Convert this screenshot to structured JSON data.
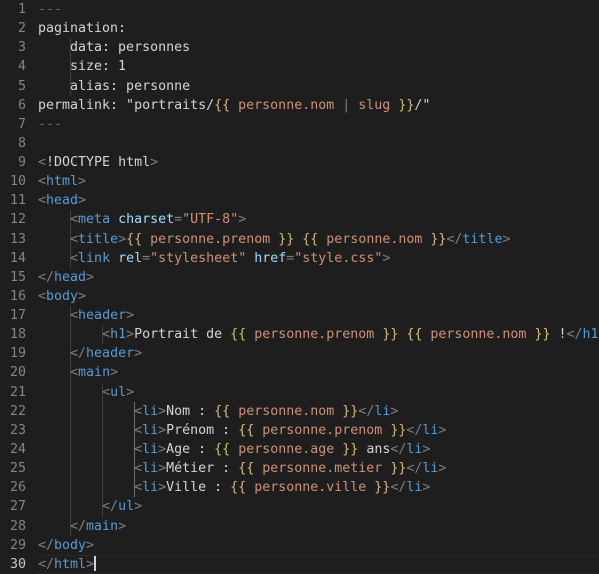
{
  "editor": {
    "theme_name": "dark-plus",
    "background_color": "#1e1e1e",
    "gutter_text_color": "#858585",
    "active_line_number_color": "#c6c6c6",
    "default_text_color": "#d4d4d4",
    "total_lines": 30,
    "active_line": 30,
    "cursor_line": 30,
    "cursor_column": 8,
    "tab_size": 4,
    "colors": {
      "tag": "#569cd6",
      "bracket": "#808080",
      "attribute": "#9cdcfe",
      "string": "#ce9178",
      "template_delimiter": "#d7ba7d",
      "variable": "#ce9178",
      "comment_dim": "#6a6a6a",
      "indent_guide": "#404040",
      "indent_guide_active": "#707070",
      "cursor": "#d4d4d4"
    },
    "lines": [
      {
        "num": "1",
        "indent": 0,
        "tokens": [
          {
            "t": "---",
            "c": "t-dim"
          }
        ]
      },
      {
        "num": "2",
        "indent": 0,
        "tokens": [
          {
            "t": "pagination:",
            "c": "t-plain"
          }
        ]
      },
      {
        "num": "3",
        "indent": 1,
        "tokens": [
          {
            "t": "    data: personnes",
            "c": "t-plain"
          }
        ]
      },
      {
        "num": "4",
        "indent": 1,
        "tokens": [
          {
            "t": "    size: 1",
            "c": "t-plain"
          }
        ]
      },
      {
        "num": "5",
        "indent": 1,
        "tokens": [
          {
            "t": "    alias: personne",
            "c": "t-plain"
          }
        ]
      },
      {
        "num": "6",
        "indent": 0,
        "tokens": [
          {
            "t": "permalink: \"portraits/",
            "c": "t-plain"
          },
          {
            "t": "{{",
            "c": "t-delim"
          },
          {
            "t": " ",
            "c": "t-plain"
          },
          {
            "t": "personne.nom",
            "c": "t-var"
          },
          {
            "t": " ",
            "c": "t-plain"
          },
          {
            "t": "|",
            "c": "t-op"
          },
          {
            "t": " ",
            "c": "t-plain"
          },
          {
            "t": "slug",
            "c": "t-var"
          },
          {
            "t": " ",
            "c": "t-plain"
          },
          {
            "t": "}}",
            "c": "t-delim"
          },
          {
            "t": "/\"",
            "c": "t-plain"
          }
        ]
      },
      {
        "num": "7",
        "indent": 0,
        "tokens": [
          {
            "t": "---",
            "c": "t-dim"
          }
        ]
      },
      {
        "num": "8",
        "indent": 0,
        "tokens": []
      },
      {
        "num": "9",
        "indent": 0,
        "tokens": [
          {
            "t": "<",
            "c": "t-brack"
          },
          {
            "t": "!DOCTYPE",
            "c": "t-plain"
          },
          {
            "t": " ",
            "c": "t-plain"
          },
          {
            "t": "html",
            "c": "t-plain"
          },
          {
            "t": ">",
            "c": "t-brack"
          }
        ]
      },
      {
        "num": "10",
        "indent": 0,
        "tokens": [
          {
            "t": "<",
            "c": "t-brack"
          },
          {
            "t": "html",
            "c": "t-tag"
          },
          {
            "t": ">",
            "c": "t-brack"
          }
        ]
      },
      {
        "num": "11",
        "indent": 0,
        "tokens": [
          {
            "t": "<",
            "c": "t-brack"
          },
          {
            "t": "head",
            "c": "t-tag"
          },
          {
            "t": ">",
            "c": "t-brack"
          }
        ]
      },
      {
        "num": "12",
        "indent": 1,
        "tokens": [
          {
            "t": "    ",
            "c": "t-plain"
          },
          {
            "t": "<",
            "c": "t-brack"
          },
          {
            "t": "meta",
            "c": "t-tag"
          },
          {
            "t": " ",
            "c": "t-plain"
          },
          {
            "t": "charset",
            "c": "t-attr"
          },
          {
            "t": "=",
            "c": "t-brack"
          },
          {
            "t": "\"UTF-8\"",
            "c": "t-str"
          },
          {
            "t": ">",
            "c": "t-brack"
          }
        ]
      },
      {
        "num": "13",
        "indent": 1,
        "tokens": [
          {
            "t": "    ",
            "c": "t-plain"
          },
          {
            "t": "<",
            "c": "t-brack"
          },
          {
            "t": "title",
            "c": "t-tag"
          },
          {
            "t": ">",
            "c": "t-brack"
          },
          {
            "t": "{{",
            "c": "t-delim"
          },
          {
            "t": " ",
            "c": "t-plain"
          },
          {
            "t": "personne.prenom",
            "c": "t-var"
          },
          {
            "t": " ",
            "c": "t-plain"
          },
          {
            "t": "}}",
            "c": "t-delim"
          },
          {
            "t": " ",
            "c": "t-plain"
          },
          {
            "t": "{{",
            "c": "t-delim"
          },
          {
            "t": " ",
            "c": "t-plain"
          },
          {
            "t": "personne.nom",
            "c": "t-var"
          },
          {
            "t": " ",
            "c": "t-plain"
          },
          {
            "t": "}}",
            "c": "t-delim"
          },
          {
            "t": "</",
            "c": "t-brack"
          },
          {
            "t": "title",
            "c": "t-tag"
          },
          {
            "t": ">",
            "c": "t-brack"
          }
        ]
      },
      {
        "num": "14",
        "indent": 1,
        "tokens": [
          {
            "t": "    ",
            "c": "t-plain"
          },
          {
            "t": "<",
            "c": "t-brack"
          },
          {
            "t": "link",
            "c": "t-tag"
          },
          {
            "t": " ",
            "c": "t-plain"
          },
          {
            "t": "rel",
            "c": "t-attr"
          },
          {
            "t": "=",
            "c": "t-brack"
          },
          {
            "t": "\"stylesheet\"",
            "c": "t-str"
          },
          {
            "t": " ",
            "c": "t-plain"
          },
          {
            "t": "href",
            "c": "t-attr"
          },
          {
            "t": "=",
            "c": "t-brack"
          },
          {
            "t": "\"style.css\"",
            "c": "t-str"
          },
          {
            "t": ">",
            "c": "t-brack"
          }
        ]
      },
      {
        "num": "15",
        "indent": 0,
        "tokens": [
          {
            "t": "</",
            "c": "t-brack"
          },
          {
            "t": "head",
            "c": "t-tag"
          },
          {
            "t": ">",
            "c": "t-brack"
          }
        ]
      },
      {
        "num": "16",
        "indent": 0,
        "tokens": [
          {
            "t": "<",
            "c": "t-brack"
          },
          {
            "t": "body",
            "c": "t-tag"
          },
          {
            "t": ">",
            "c": "t-brack"
          }
        ]
      },
      {
        "num": "17",
        "indent": 1,
        "tokens": [
          {
            "t": "    ",
            "c": "t-plain"
          },
          {
            "t": "<",
            "c": "t-brack"
          },
          {
            "t": "header",
            "c": "t-tag"
          },
          {
            "t": ">",
            "c": "t-brack"
          }
        ]
      },
      {
        "num": "18",
        "indent": 2,
        "tokens": [
          {
            "t": "        ",
            "c": "t-plain"
          },
          {
            "t": "<",
            "c": "t-brack"
          },
          {
            "t": "h1",
            "c": "t-tag"
          },
          {
            "t": ">",
            "c": "t-brack"
          },
          {
            "t": "Portrait de ",
            "c": "t-plain"
          },
          {
            "t": "{{",
            "c": "t-delim"
          },
          {
            "t": " ",
            "c": "t-plain"
          },
          {
            "t": "personne.prenom",
            "c": "t-var"
          },
          {
            "t": " ",
            "c": "t-plain"
          },
          {
            "t": "}}",
            "c": "t-delim"
          },
          {
            "t": " ",
            "c": "t-plain"
          },
          {
            "t": "{{",
            "c": "t-delim"
          },
          {
            "t": " ",
            "c": "t-plain"
          },
          {
            "t": "personne.nom",
            "c": "t-var"
          },
          {
            "t": " ",
            "c": "t-plain"
          },
          {
            "t": "}}",
            "c": "t-delim"
          },
          {
            "t": " !",
            "c": "t-plain"
          },
          {
            "t": "</",
            "c": "t-brack"
          },
          {
            "t": "h1",
            "c": "t-tag"
          },
          {
            "t": ">",
            "c": "t-brack"
          }
        ]
      },
      {
        "num": "19",
        "indent": 1,
        "tokens": [
          {
            "t": "    ",
            "c": "t-plain"
          },
          {
            "t": "</",
            "c": "t-brack"
          },
          {
            "t": "header",
            "c": "t-tag"
          },
          {
            "t": ">",
            "c": "t-brack"
          }
        ]
      },
      {
        "num": "20",
        "indent": 1,
        "tokens": [
          {
            "t": "    ",
            "c": "t-plain"
          },
          {
            "t": "<",
            "c": "t-brack"
          },
          {
            "t": "main",
            "c": "t-tag"
          },
          {
            "t": ">",
            "c": "t-brack"
          }
        ]
      },
      {
        "num": "21",
        "indent": 2,
        "tokens": [
          {
            "t": "        ",
            "c": "t-plain"
          },
          {
            "t": "<",
            "c": "t-brack"
          },
          {
            "t": "ul",
            "c": "t-tag"
          },
          {
            "t": ">",
            "c": "t-brack"
          }
        ]
      },
      {
        "num": "22",
        "indent": 3,
        "tokens": [
          {
            "t": "            ",
            "c": "t-plain"
          },
          {
            "t": "<",
            "c": "t-brack"
          },
          {
            "t": "li",
            "c": "t-tag"
          },
          {
            "t": ">",
            "c": "t-brack"
          },
          {
            "t": "Nom : ",
            "c": "t-plain"
          },
          {
            "t": "{{",
            "c": "t-delim"
          },
          {
            "t": " ",
            "c": "t-plain"
          },
          {
            "t": "personne.nom",
            "c": "t-var"
          },
          {
            "t": " ",
            "c": "t-plain"
          },
          {
            "t": "}}",
            "c": "t-delim"
          },
          {
            "t": "</",
            "c": "t-brack"
          },
          {
            "t": "li",
            "c": "t-tag"
          },
          {
            "t": ">",
            "c": "t-brack"
          }
        ]
      },
      {
        "num": "23",
        "indent": 3,
        "tokens": [
          {
            "t": "            ",
            "c": "t-plain"
          },
          {
            "t": "<",
            "c": "t-brack"
          },
          {
            "t": "li",
            "c": "t-tag"
          },
          {
            "t": ">",
            "c": "t-brack"
          },
          {
            "t": "Prénom : ",
            "c": "t-plain"
          },
          {
            "t": "{{",
            "c": "t-delim"
          },
          {
            "t": " ",
            "c": "t-plain"
          },
          {
            "t": "personne.prenom",
            "c": "t-var"
          },
          {
            "t": " ",
            "c": "t-plain"
          },
          {
            "t": "}}",
            "c": "t-delim"
          },
          {
            "t": "</",
            "c": "t-brack"
          },
          {
            "t": "li",
            "c": "t-tag"
          },
          {
            "t": ">",
            "c": "t-brack"
          }
        ]
      },
      {
        "num": "24",
        "indent": 3,
        "tokens": [
          {
            "t": "            ",
            "c": "t-plain"
          },
          {
            "t": "<",
            "c": "t-brack"
          },
          {
            "t": "li",
            "c": "t-tag"
          },
          {
            "t": ">",
            "c": "t-brack"
          },
          {
            "t": "Age : ",
            "c": "t-plain"
          },
          {
            "t": "{{",
            "c": "t-delim"
          },
          {
            "t": " ",
            "c": "t-plain"
          },
          {
            "t": "personne.age",
            "c": "t-var"
          },
          {
            "t": " ",
            "c": "t-plain"
          },
          {
            "t": "}}",
            "c": "t-delim"
          },
          {
            "t": " ans",
            "c": "t-plain"
          },
          {
            "t": "</",
            "c": "t-brack"
          },
          {
            "t": "li",
            "c": "t-tag"
          },
          {
            "t": ">",
            "c": "t-brack"
          }
        ]
      },
      {
        "num": "25",
        "indent": 3,
        "tokens": [
          {
            "t": "            ",
            "c": "t-plain"
          },
          {
            "t": "<",
            "c": "t-brack"
          },
          {
            "t": "li",
            "c": "t-tag"
          },
          {
            "t": ">",
            "c": "t-brack"
          },
          {
            "t": "Métier : ",
            "c": "t-plain"
          },
          {
            "t": "{{",
            "c": "t-delim"
          },
          {
            "t": " ",
            "c": "t-plain"
          },
          {
            "t": "personne.metier",
            "c": "t-var"
          },
          {
            "t": " ",
            "c": "t-plain"
          },
          {
            "t": "}}",
            "c": "t-delim"
          },
          {
            "t": "</",
            "c": "t-brack"
          },
          {
            "t": "li",
            "c": "t-tag"
          },
          {
            "t": ">",
            "c": "t-brack"
          }
        ]
      },
      {
        "num": "26",
        "indent": 3,
        "tokens": [
          {
            "t": "            ",
            "c": "t-plain"
          },
          {
            "t": "<",
            "c": "t-brack"
          },
          {
            "t": "li",
            "c": "t-tag"
          },
          {
            "t": ">",
            "c": "t-brack"
          },
          {
            "t": "Ville : ",
            "c": "t-plain"
          },
          {
            "t": "{{",
            "c": "t-delim"
          },
          {
            "t": " ",
            "c": "t-plain"
          },
          {
            "t": "personne.ville",
            "c": "t-var"
          },
          {
            "t": " ",
            "c": "t-plain"
          },
          {
            "t": "}}",
            "c": "t-delim"
          },
          {
            "t": "</",
            "c": "t-brack"
          },
          {
            "t": "li",
            "c": "t-tag"
          },
          {
            "t": ">",
            "c": "t-brack"
          }
        ]
      },
      {
        "num": "27",
        "indent": 2,
        "tokens": [
          {
            "t": "        ",
            "c": "t-plain"
          },
          {
            "t": "</",
            "c": "t-brack"
          },
          {
            "t": "ul",
            "c": "t-tag"
          },
          {
            "t": ">",
            "c": "t-brack"
          }
        ]
      },
      {
        "num": "28",
        "indent": 1,
        "tokens": [
          {
            "t": "    ",
            "c": "t-plain"
          },
          {
            "t": "</",
            "c": "t-brack"
          },
          {
            "t": "main",
            "c": "t-tag"
          },
          {
            "t": ">",
            "c": "t-brack"
          }
        ]
      },
      {
        "num": "29",
        "indent": 0,
        "tokens": [
          {
            "t": "</",
            "c": "t-brack"
          },
          {
            "t": "body",
            "c": "t-tag"
          },
          {
            "t": ">",
            "c": "t-brack"
          }
        ]
      },
      {
        "num": "30",
        "indent": 0,
        "active": true,
        "cursor": true,
        "tokens": [
          {
            "t": "</",
            "c": "t-brack"
          },
          {
            "t": "html",
            "c": "t-tag"
          },
          {
            "t": ">",
            "c": "t-brack"
          }
        ]
      }
    ],
    "indent_guides": [
      {
        "level": 1,
        "from_line": 3,
        "to_line": 5,
        "bright": false
      },
      {
        "level": 1,
        "from_line": 12,
        "to_line": 14,
        "bright": false
      },
      {
        "level": 1,
        "from_line": 17,
        "to_line": 28,
        "bright": false
      },
      {
        "level": 2,
        "from_line": 18,
        "to_line": 18,
        "bright": false
      },
      {
        "level": 2,
        "from_line": 21,
        "to_line": 27,
        "bright": false
      },
      {
        "level": 3,
        "from_line": 22,
        "to_line": 26,
        "bright": true
      }
    ]
  }
}
